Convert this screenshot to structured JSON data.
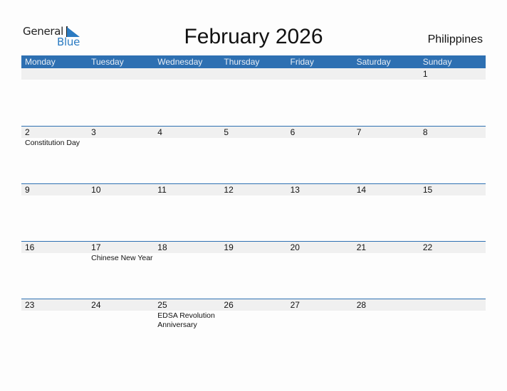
{
  "logo": {
    "general": "General",
    "blue": "Blue"
  },
  "title": "February 2026",
  "country": "Philippines",
  "colors": {
    "header": "#2e70b2",
    "strip": "#f0f0f0",
    "brand": "#2b7bc2"
  },
  "weekdays": [
    "Monday",
    "Tuesday",
    "Wednesday",
    "Thursday",
    "Friday",
    "Saturday",
    "Sunday"
  ],
  "weeks": [
    [
      {
        "d": ""
      },
      {
        "d": ""
      },
      {
        "d": ""
      },
      {
        "d": ""
      },
      {
        "d": ""
      },
      {
        "d": ""
      },
      {
        "d": "1"
      }
    ],
    [
      {
        "d": "2",
        "e": "Constitution Day"
      },
      {
        "d": "3"
      },
      {
        "d": "4"
      },
      {
        "d": "5"
      },
      {
        "d": "6"
      },
      {
        "d": "7"
      },
      {
        "d": "8"
      }
    ],
    [
      {
        "d": "9"
      },
      {
        "d": "10"
      },
      {
        "d": "11"
      },
      {
        "d": "12"
      },
      {
        "d": "13"
      },
      {
        "d": "14"
      },
      {
        "d": "15"
      }
    ],
    [
      {
        "d": "16"
      },
      {
        "d": "17",
        "e": "Chinese New Year"
      },
      {
        "d": "18"
      },
      {
        "d": "19"
      },
      {
        "d": "20"
      },
      {
        "d": "21"
      },
      {
        "d": "22"
      }
    ],
    [
      {
        "d": "23"
      },
      {
        "d": "24"
      },
      {
        "d": "25",
        "e": "EDSA Revolution Anniversary"
      },
      {
        "d": "26"
      },
      {
        "d": "27"
      },
      {
        "d": "28"
      },
      {
        "d": ""
      }
    ]
  ]
}
